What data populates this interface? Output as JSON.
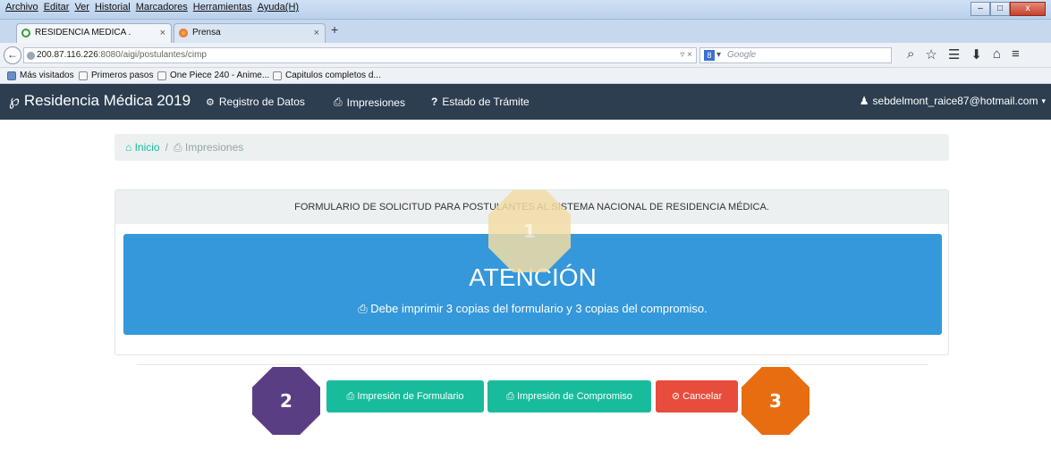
{
  "menu": [
    "Archivo",
    "Editar",
    "Ver",
    "Historial",
    "Marcadores",
    "Herramientas",
    "Ayuda(H)"
  ],
  "window_controls": [
    "–",
    "□",
    "x"
  ],
  "tabs": [
    {
      "title": "RESIDENCIA MEDICA .",
      "close": "×",
      "icon": "loading-icon"
    },
    {
      "title": "Prensa",
      "close": "×",
      "icon": "firefox-icon"
    }
  ],
  "new_tab": "+",
  "address": {
    "host": "200.87.116.226",
    "rest": ":8080/aigi/postulantes/cimp",
    "controls": "▿ ×"
  },
  "search": {
    "engine": "8",
    "caret": "▾",
    "placeholder": "Google"
  },
  "toolbar_icons": [
    "⌕",
    "☆",
    "☰",
    "⬇",
    "⌂",
    "≡"
  ],
  "bookmarks": [
    "Más visitados",
    "Primeros pasos",
    "One Piece 240 - Anime...",
    "Capitulos completos d..."
  ],
  "site": {
    "brand": "Residencia Médica 2019",
    "nav": [
      "Registro de Datos",
      "Impresiones",
      "Estado de Trámite"
    ],
    "user": "sebdelmont_raice87@hotmail.com"
  },
  "breadcrumb": {
    "home": "Inicio",
    "sep": "/",
    "current": "Impresiones"
  },
  "panel": {
    "heading": "FORMULARIO DE SOLICITUD PARA POSTULANTES AL SISTEMA NACIONAL DE RESIDENCIA MÉDICA.",
    "alert_title": "ATENCIÓN",
    "alert_text": "Debe imprimir 3 copias del formulario y 3 copias del compromiso."
  },
  "buttons": {
    "form": "Impresión de Formulario",
    "commit": "Impresión de Compromiso",
    "cancel": "Cancelar"
  },
  "callouts": [
    "1",
    "2",
    "3"
  ],
  "colors": {
    "navbar": "#2c3e50",
    "success": "#18bc9c",
    "danger": "#e74c3c",
    "info": "#3498db",
    "callout2": "#5a3e84",
    "callout3": "#e86d10"
  }
}
